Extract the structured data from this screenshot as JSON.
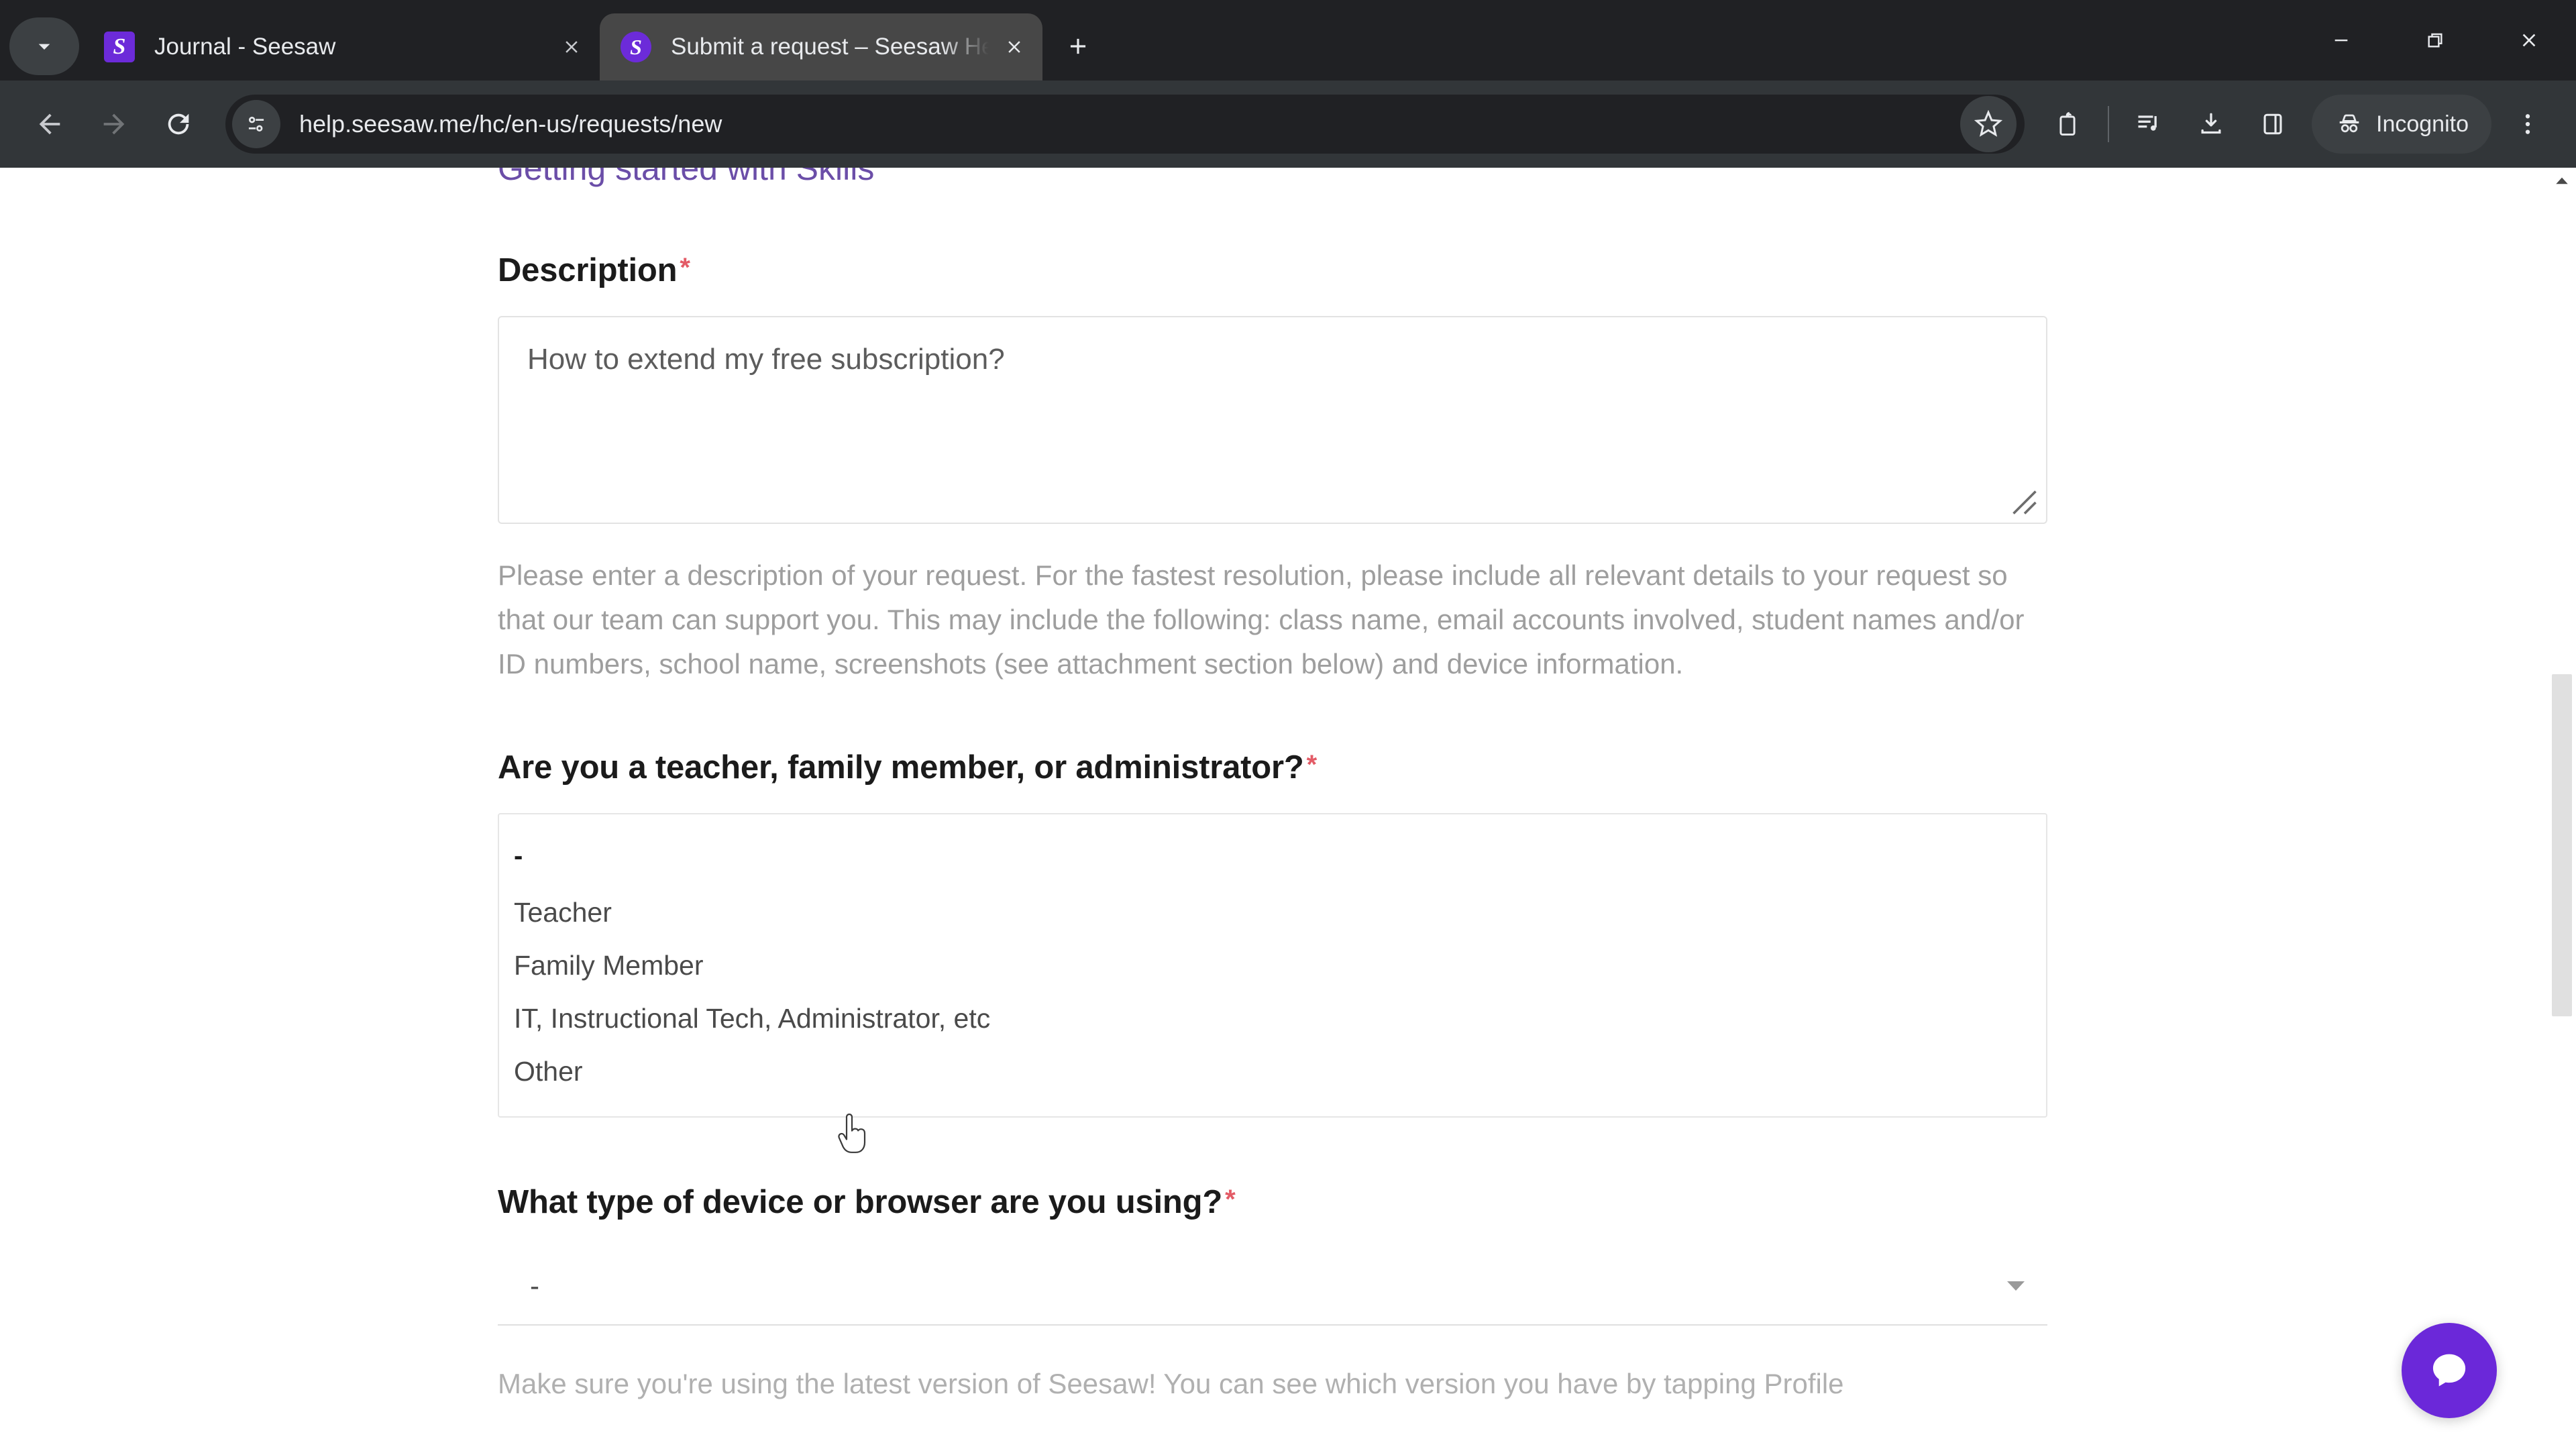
{
  "browser": {
    "tab_search_icon": "chevron-down-icon",
    "tabs": [
      {
        "title": "Journal - Seesaw",
        "favicon": "seesaw-favicon",
        "active": false
      },
      {
        "title": "Submit a request – Seesaw Help Center",
        "favicon": "seesaw-favicon",
        "active": true
      }
    ],
    "new_tab_label": "+",
    "window_controls": {
      "minimize": "minimize-icon",
      "maximize": "restore-icon",
      "close": "close-icon"
    },
    "toolbar": {
      "back": "back-arrow-icon",
      "forward": "forward-arrow-icon",
      "reload": "reload-icon",
      "site_info": "site-settings-icon",
      "url": "help.seesaw.me/hc/en-us/requests/new",
      "bookmark": "star-icon",
      "extensions": "extensions-puzzle-icon",
      "media": "media-playlist-icon",
      "downloads": "download-icon",
      "side_panel": "side-panel-icon",
      "incognito_label": "Incognito",
      "menu": "three-dot-menu-icon"
    }
  },
  "page": {
    "clipped_link": "Getting started with Skills",
    "description": {
      "label": "Description",
      "required_marker": "*",
      "value": "How to extend my free subscription?",
      "placeholder": "",
      "help": "Please enter a description of your request. For the fastest resolution, please include all relevant details to your request so that our team can support you. This may include the following: class name, email accounts involved, student names and/or ID numbers, school name, screenshots (see attachment section below) and device information."
    },
    "role_question": {
      "label": "Are you a teacher, family member, or administrator?",
      "required_marker": "*",
      "options": [
        "-",
        "Teacher",
        "Family Member",
        "IT, Instructional Tech, Administrator, etc",
        "Other"
      ]
    },
    "device_question": {
      "label": "What type of device or browser are you using?",
      "required_marker": "*",
      "selected": "-",
      "help": "Make sure you're using the latest version of Seesaw! You can see which version you have by tapping Profile"
    },
    "chat_widget": {
      "icon": "chat-bubble-icon"
    }
  },
  "colors": {
    "accent_purple": "#6b28d9",
    "link_purple": "#6b4ea8",
    "required_red": "#e35b66",
    "chrome_dark": "#202124",
    "toolbar_dark": "#323639",
    "active_tab": "#474747"
  }
}
